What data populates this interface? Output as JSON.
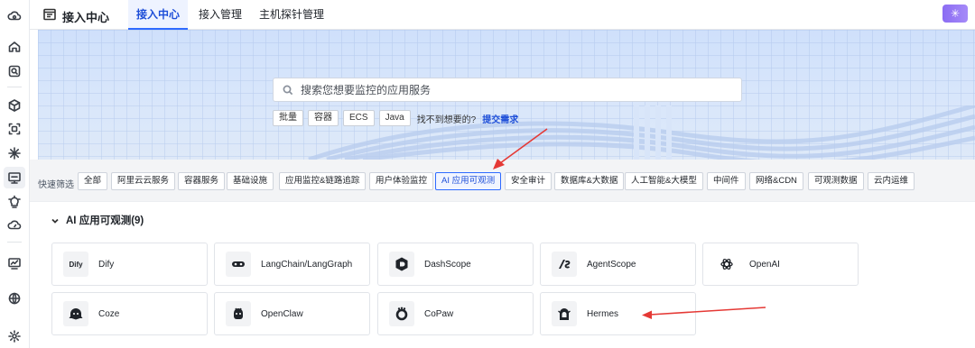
{
  "topbar": {
    "title": "接入中心",
    "tabs": [
      {
        "label": "接入中心",
        "active": true
      },
      {
        "label": "接入管理",
        "active": false
      },
      {
        "label": "主机探针管理",
        "active": false
      }
    ],
    "action_icon": "sparkle-icon"
  },
  "search": {
    "placeholder": "搜索您想要监控的应用服务",
    "quick_tags": [
      "批量",
      "容器",
      "ECS",
      "Java"
    ],
    "hint": "找不到想要的?",
    "hint_link": "提交需求"
  },
  "filters": {
    "label": "快速筛选",
    "items": [
      "全部",
      "阿里云云服务",
      "容器服务",
      "基础设施",
      "应用监控&链路追踪",
      "用户体验监控",
      "AI 应用可观测",
      "安全审计",
      "数据库&大数据",
      "人工智能&大模型",
      "中间件",
      "网络&CDN",
      "可观测数据",
      "云内运维"
    ],
    "active": "AI 应用可观测"
  },
  "section": {
    "title": "AI 应用可观测(9)",
    "cards": [
      {
        "name": "Dify",
        "icon": "dify-logo-icon",
        "logo_text": "Dify"
      },
      {
        "name": "LangChain/LangGraph",
        "icon": "langchain-logo-icon"
      },
      {
        "name": "DashScope",
        "icon": "dashscope-logo-icon"
      },
      {
        "name": "AgentScope",
        "icon": "agentscope-logo-icon"
      },
      {
        "name": "OpenAI",
        "icon": "openai-logo-icon"
      },
      {
        "name": "Coze",
        "icon": "coze-logo-icon"
      },
      {
        "name": "OpenClaw",
        "icon": "openclaw-logo-icon"
      },
      {
        "name": "CoPaw",
        "icon": "copaw-logo-icon"
      },
      {
        "name": "Hermes",
        "icon": "hermes-logo-icon"
      }
    ]
  },
  "colors": {
    "accent": "#2f6bff",
    "annotation_arrow": "#e53935"
  }
}
